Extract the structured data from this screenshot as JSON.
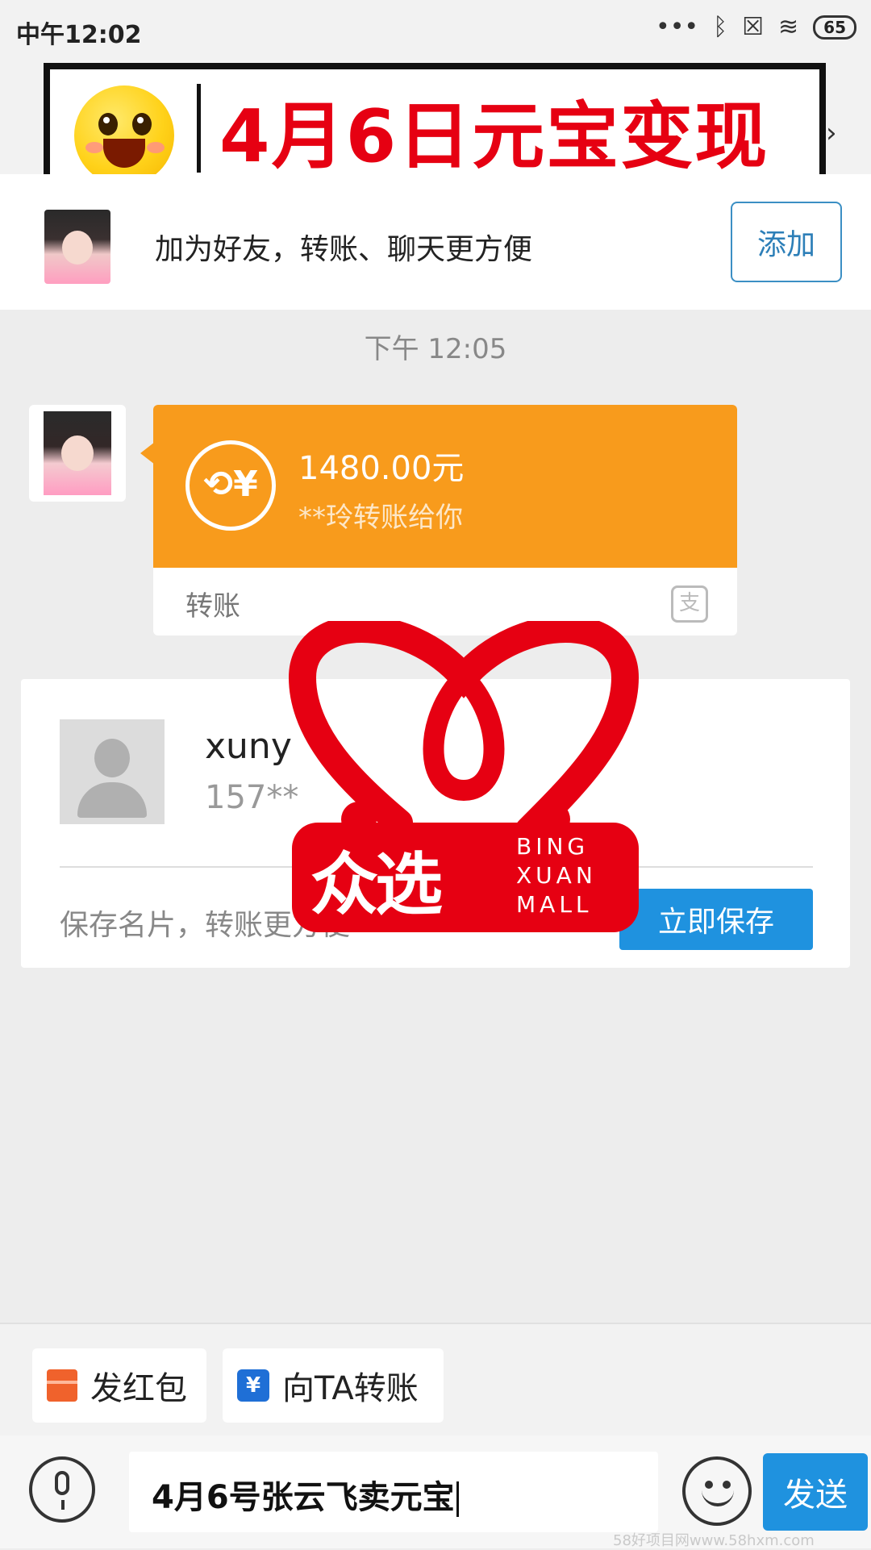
{
  "status_bar": {
    "time": "中午12:02",
    "battery": "65"
  },
  "banner": {
    "title": "4月6日元宝变现"
  },
  "friend_prompt": {
    "text": "加为好友，转账、聊天更方便",
    "add_label": "添加"
  },
  "chat": {
    "timestamp": "下午 12:05",
    "transfer": {
      "amount": "1480.00元",
      "from_text": "**玲转账给你",
      "label": "转账"
    },
    "contact_card": {
      "name": "xuny",
      "phone": "157**",
      "hint": "保存名片，转账更方便",
      "save_label": "立即保存"
    }
  },
  "watermark_logo": {
    "chinese": "众选",
    "english_lines": [
      "BING",
      "XUAN",
      "MALL"
    ],
    "brand_color": "#e60012"
  },
  "quick_actions": {
    "red_packet": "发红包",
    "transfer_to": "向TA转账"
  },
  "input_bar": {
    "text": "4月6号张云飞卖元宝",
    "send_label": "发送"
  },
  "footer_watermark": "58好项目网www.58hxm.com",
  "colors": {
    "accent_blue": "#1f92df",
    "transfer_orange": "#f89b1c",
    "banner_red": "#e60012"
  }
}
